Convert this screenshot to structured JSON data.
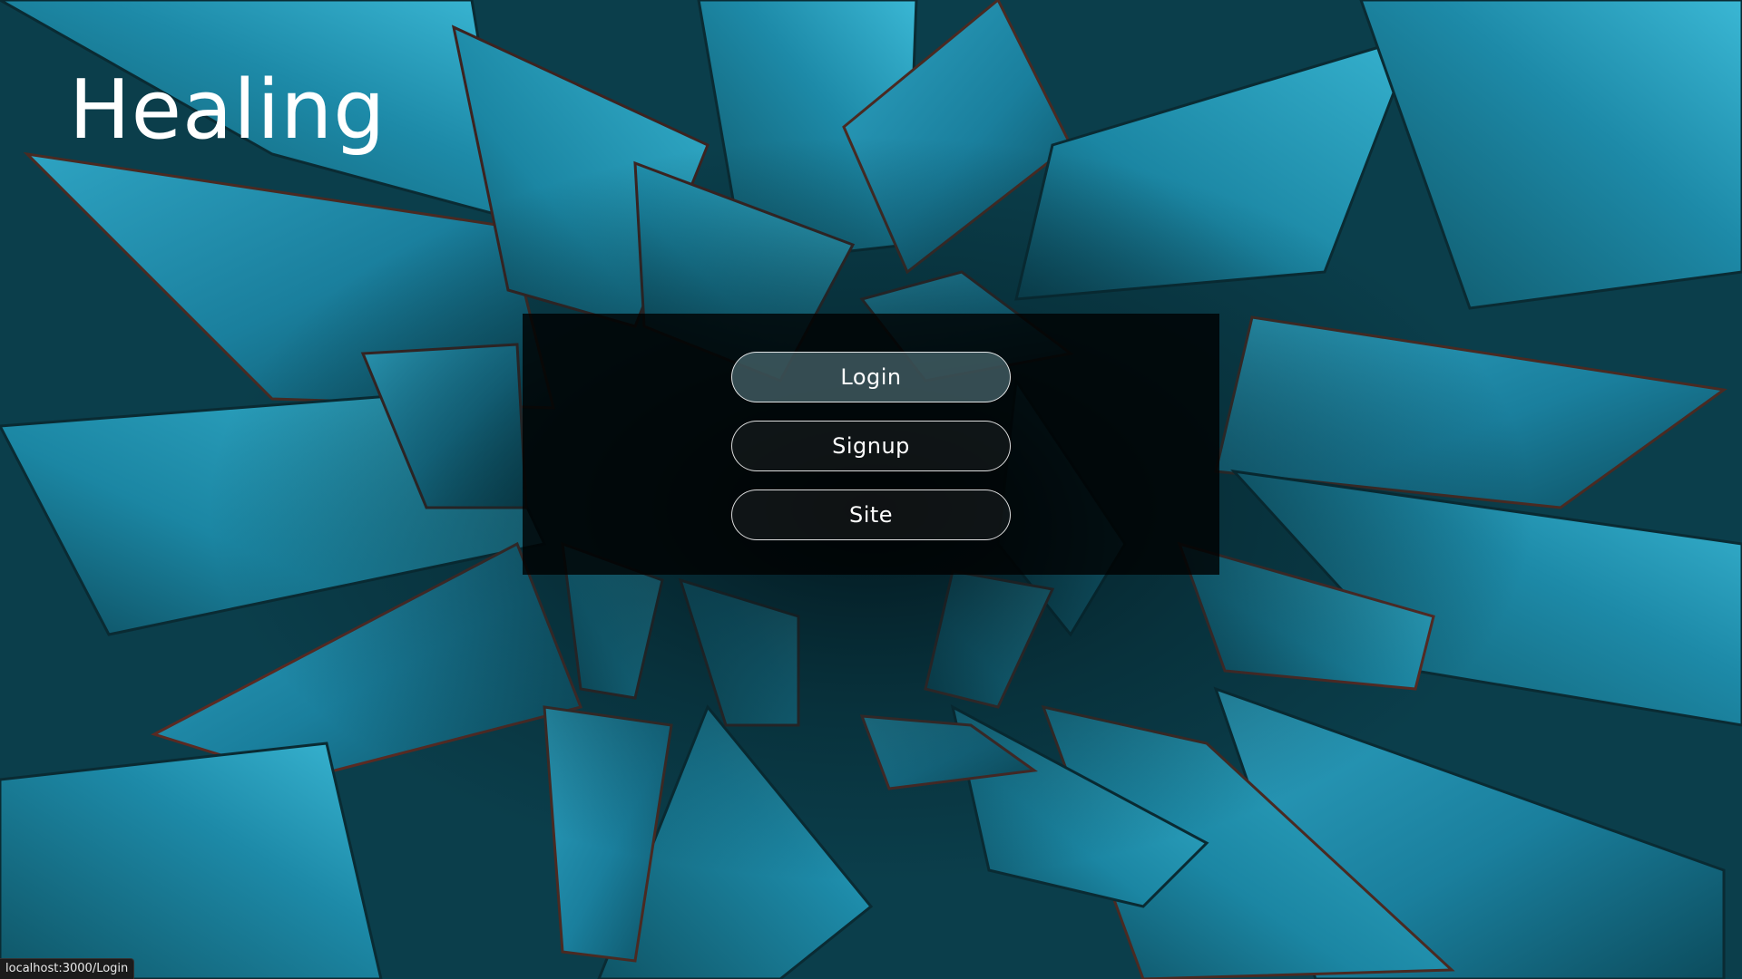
{
  "app": {
    "brand": "Healing"
  },
  "menu": {
    "buttons": [
      {
        "label": "Login",
        "active": true
      },
      {
        "label": "Signup",
        "active": false
      },
      {
        "label": "Site",
        "active": false
      }
    ]
  },
  "status_bar": {
    "url": "localhost:3000/Login"
  },
  "colors": {
    "panel_overlay": "#000000",
    "button_border": "#ffffff",
    "button_active_fill": "#8cbec8",
    "text": "#ffffff",
    "background_teal": "#10586a"
  }
}
